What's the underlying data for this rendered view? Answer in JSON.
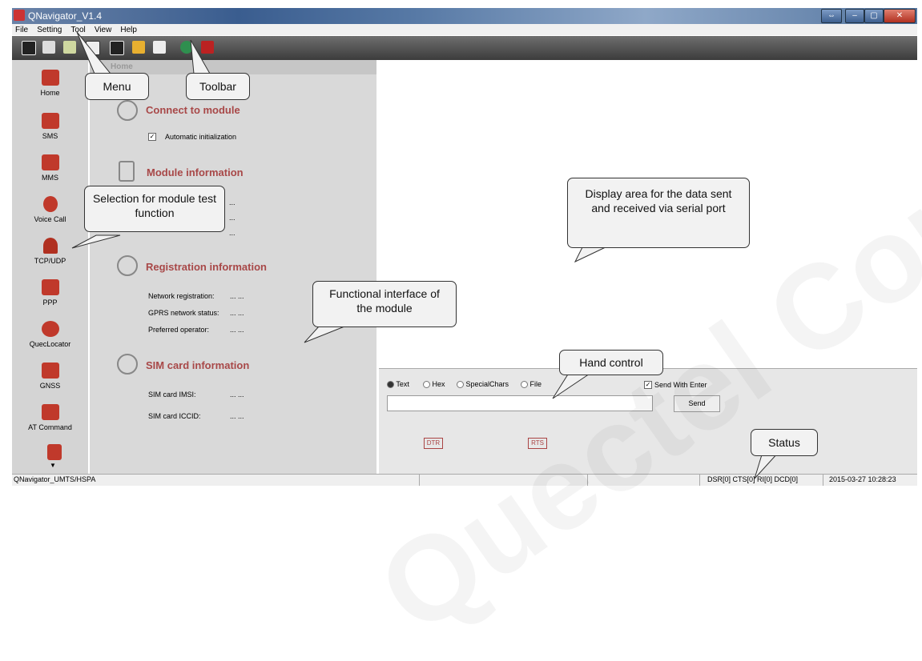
{
  "window": {
    "title": "QNavigator_V1.4"
  },
  "menu": [
    "File",
    "Setting",
    "Tool",
    "View",
    "Help"
  ],
  "toolbar_icons": [
    "save-icon",
    "settings-icon",
    "filter-icon",
    "copy-icon",
    "save-log-icon",
    "clear-icon",
    "list-icon",
    "globe-icon",
    "book-icon"
  ],
  "sidebar": {
    "items": [
      {
        "label": "Home",
        "icon": "home-icon"
      },
      {
        "label": "SMS",
        "icon": "sms-icon"
      },
      {
        "label": "MMS",
        "icon": "mms-icon"
      },
      {
        "label": "Voice Call",
        "icon": "phone-icon"
      },
      {
        "label": "TCP/UDP",
        "icon": "wifi-icon"
      },
      {
        "label": "PPP",
        "icon": "chat-icon"
      },
      {
        "label": "QuecLocator",
        "icon": "globe-locator-icon"
      },
      {
        "label": "GNSS",
        "icon": "satellite-icon"
      },
      {
        "label": "AT Command",
        "icon": "terminal-icon"
      }
    ]
  },
  "panel": {
    "header": "Home",
    "connect": {
      "title": "Connect to module",
      "auto_init": "Automatic initialization"
    },
    "module_info": {
      "title": "Module information",
      "values": [
        "...",
        "...",
        "..."
      ]
    },
    "registration": {
      "title": "Registration information",
      "rows": [
        {
          "label": "Network registration:",
          "value": "... ..."
        },
        {
          "label": "GPRS network status:",
          "value": "... ..."
        },
        {
          "label": "Preferred operator:",
          "value": "... ..."
        }
      ]
    },
    "sim": {
      "title": "SIM card information",
      "rows": [
        {
          "label": "SIM card IMSI:",
          "value": "... ..."
        },
        {
          "label": "SIM card ICCID:",
          "value": "... ..."
        }
      ]
    }
  },
  "send": {
    "modes": [
      "Text",
      "Hex",
      "SpecialChars",
      "File"
    ],
    "send_with_enter": "Send With Enter",
    "send_button": "Send",
    "dtr": "DTR",
    "rts": "RTS"
  },
  "status": {
    "product": "QNavigator_UMTS/HSPA",
    "lines": "DSR[0] CTS[0] RI[0] DCD[0]",
    "datetime": "2015-03-27 10:28:23"
  },
  "callouts": {
    "menu": "Menu",
    "toolbar": "Toolbar",
    "selection": "Selection for module test function",
    "display": "Display area for the data sent and received via serial port",
    "functional": "Functional interface of the module",
    "hand": "Hand control",
    "status": "Status"
  },
  "watermark": "Quectel Confidential"
}
